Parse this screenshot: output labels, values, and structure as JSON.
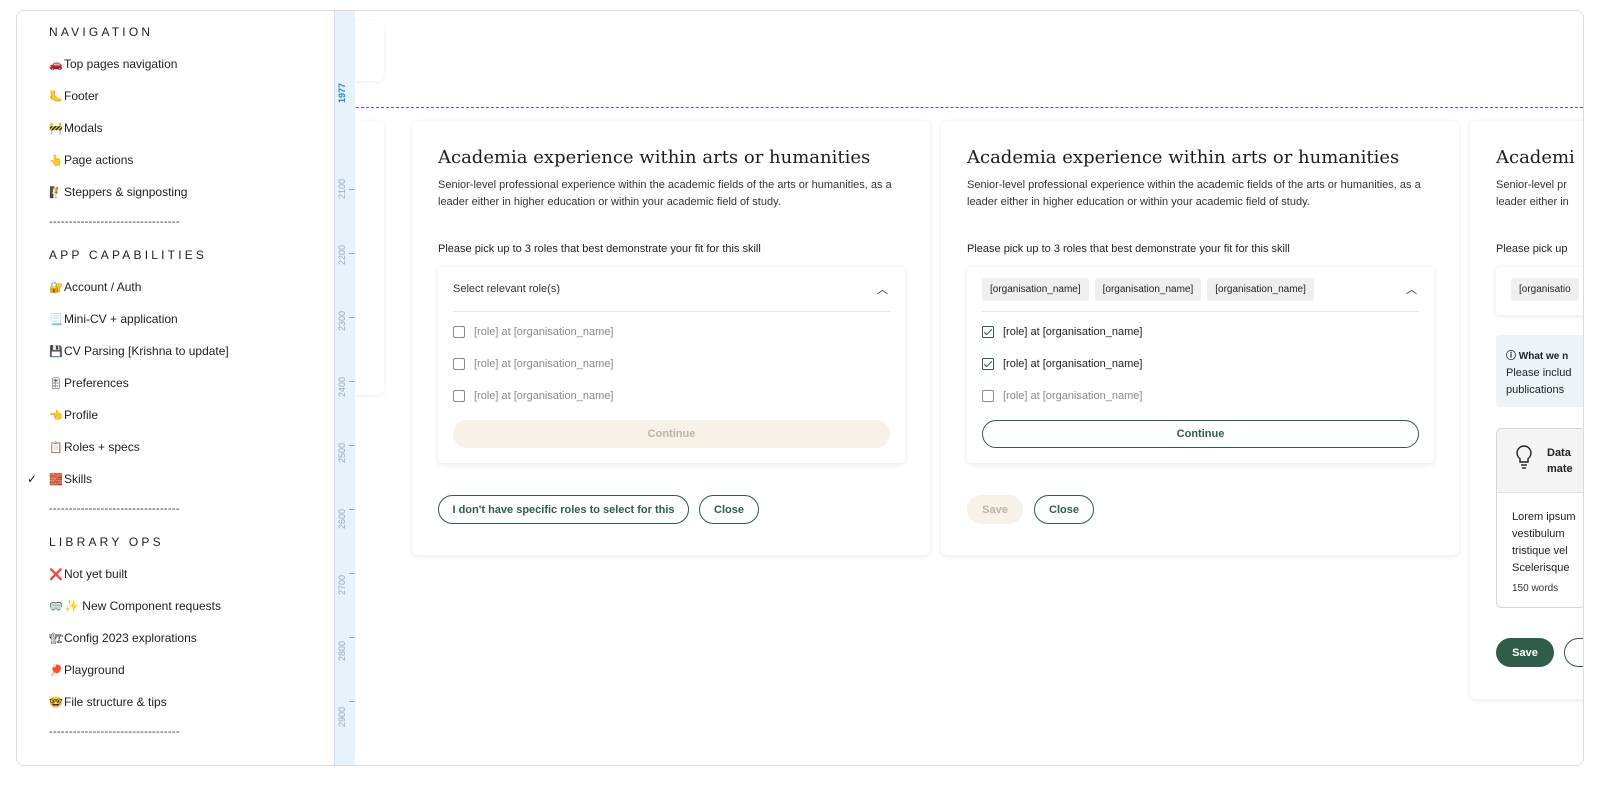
{
  "menu": {
    "sections": [
      {
        "title": "NAVIGATION"
      },
      {
        "title": "APP CAPABILITIES"
      },
      {
        "title": "LIBRARY OPS"
      }
    ],
    "divider": "---------------------------------",
    "items": [
      {
        "emoji": "🚗",
        "label": "Top pages navigation"
      },
      {
        "emoji": "🦶",
        "label": "Footer"
      },
      {
        "emoji": "🚧",
        "label": "Modals"
      },
      {
        "emoji": "👆",
        "label": "Page actions"
      },
      {
        "emoji": "🧗",
        "label": "Steppers & signposting"
      },
      {
        "emoji": "🔐",
        "label": "Account / Auth"
      },
      {
        "emoji": "📃",
        "label": "Mini-CV + application"
      },
      {
        "emoji": "💾",
        "label": "CV Parsing [Krishna to update]"
      },
      {
        "emoji": "🎚",
        "label": "Preferences"
      },
      {
        "emoji": "👈",
        "label": "Profile"
      },
      {
        "emoji": "📋",
        "label": "Roles + specs"
      },
      {
        "emoji": "🧱",
        "label": "Skills",
        "selected": true
      },
      {
        "emoji": "❌",
        "label": "Not yet built"
      },
      {
        "emoji": "🥽",
        "label": "✨ New Component requests"
      },
      {
        "emoji": "🏗",
        "label": "Config 2023 explorations"
      },
      {
        "emoji": "🏓",
        "label": "Playground"
      },
      {
        "emoji": "🤓",
        "label": "File structure & tips"
      }
    ],
    "check": "✓"
  },
  "ruler": {
    "active": "1977",
    "labels": [
      "2100",
      "2200",
      "2300",
      "2400",
      "2500",
      "2600",
      "2700",
      "2800",
      "2900"
    ]
  },
  "skill": {
    "title": "Academia experience within arts or humanities",
    "description": "Senior-level professional experience within the academic fields of the arts or humanities, as a leader either in higher education or within your academic field of study.",
    "prompt": "Please pick up to 3 roles that best demonstrate your fit for this skill",
    "placeholder": "Select relevant role(s)",
    "option": "[role] at [organisation_name]",
    "chip": "[organisation_name]",
    "continue": "Continue",
    "no_roles": "I don't have specific roles to select for this",
    "close": "Close",
    "save": "Save"
  },
  "frame3": {
    "title_partial": "Academi",
    "desc_partial_1": "Senior-level pr",
    "desc_partial_2": "leader either in",
    "prompt_partial": "Please pick up",
    "chip_partial": "[organisatio",
    "info_title": "What we n",
    "info_line1": "Please includ",
    "info_line2": "publications",
    "card_title_1": "Data",
    "card_title_2": "mate",
    "lorem_1": "Lorem ipsum",
    "lorem_2": "vestibulum",
    "lorem_3": "tristique vel",
    "lorem_4": "Scelerisque",
    "words": "150 words",
    "save": "Save"
  },
  "colors": {
    "accent": "#2f5d4a",
    "disabled_bg": "#f7f1e8",
    "guide": "#7c3aed",
    "ruler_active": "#1b86e0"
  }
}
